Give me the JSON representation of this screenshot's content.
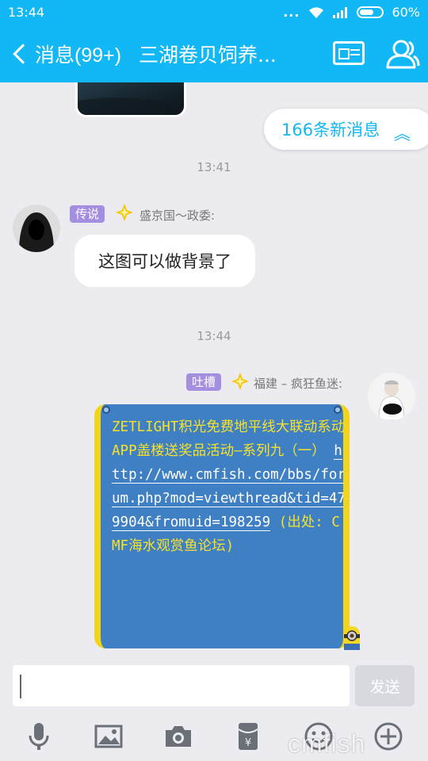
{
  "status_bar": {
    "time": "13:44",
    "signal_dots": "...",
    "battery": "60%"
  },
  "header": {
    "back_label": "消息(99+)",
    "title": "三湖卷贝饲养..."
  },
  "new_messages": {
    "label": "166条新消息",
    "arrow": "︽"
  },
  "messages": [
    {
      "timestamp": "13:41",
      "badge": "传说",
      "sender": "盛京国〜政委:",
      "text": "这图可以做背景了"
    },
    {
      "timestamp": "13:44",
      "badge": "吐槽",
      "sender": "福建 – 疯狂鱼迷:",
      "card_text_1": "ZETLIGHT积光免费地平线大联动系动APP盖楼送奖品活动—系列九（一）",
      "card_link": "http://www.cmfish.com/bbs/forum.php?mod=viewthread&tid=479904&fromuid=198259",
      "card_text_2": "(出处: CMF海水观赏鱼论坛)"
    }
  ],
  "input": {
    "value": "",
    "send_label": "发送"
  },
  "toolbar": [
    "microphone-icon",
    "image-icon",
    "camera-icon",
    "red-packet-icon",
    "emoji-icon",
    "plus-icon"
  ],
  "watermark": "cmfish",
  "colors": {
    "brand": "#12b7f5",
    "badge": "#a48ee0",
    "card_bg": "#3f7fc4",
    "card_text": "#f6e22b"
  }
}
